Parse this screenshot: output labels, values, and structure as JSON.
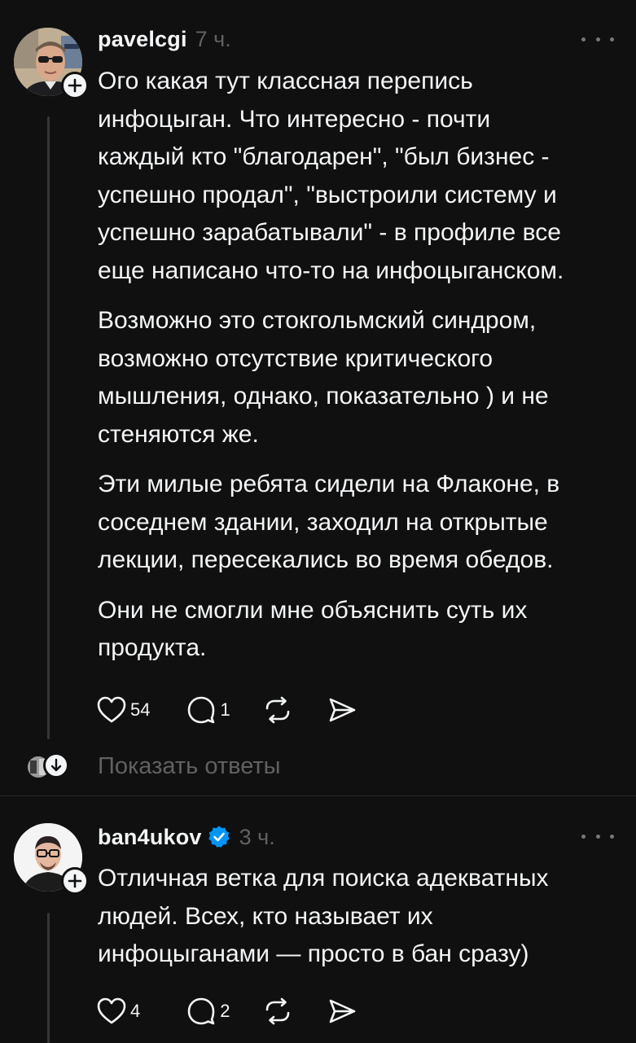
{
  "posts": [
    {
      "username": "pavelcgi",
      "time": "7 ч.",
      "paragraphs": [
        "Ого какая тут классная перепись\nинфоцыган. Что интересно - почти\nкаждый кто \"благодарен\", \"был бизнес -\nуспешно продал\", \"выстроили систему и\nуспешно зарабатывали\" - в профиле все\nеще написано что-то на инфоцыганском.",
        "Возможно это стокгольмский синдром,\nвозможно отсутствие критического\nмышления, однако, показательно ) и не\nстеняются же.",
        "Эти милые ребята сидели на Флаконе, в\nсоседнем здании, заходил на открытые\nлекции, пересекались во время обедов.",
        "Они не смогли мне объяснить суть их\nпродукта."
      ],
      "likes": "54",
      "replies": "1",
      "show_replies": "Показать ответы"
    },
    {
      "username": "ban4ukov",
      "verified": true,
      "time": "3 ч.",
      "paragraphs": [
        "Отличная ветка для поиска адекватных\nлюдей. Всех, кто называет их\nинфоцыганами — просто в бан сразу)"
      ],
      "likes": "4",
      "replies": "2"
    }
  ],
  "icons": {
    "like": "heart-icon",
    "reply": "comment-icon",
    "repost": "repost-icon",
    "share": "send-icon",
    "follow": "plus-icon",
    "more": "more-dots-icon",
    "verified": "verified-badge-icon",
    "show_replies": "arrow-down-icon"
  },
  "colors": {
    "background": "#101010",
    "text": "#f3f5f7",
    "muted": "#616161",
    "verified": "#0095f6",
    "thread_line": "#333638"
  }
}
